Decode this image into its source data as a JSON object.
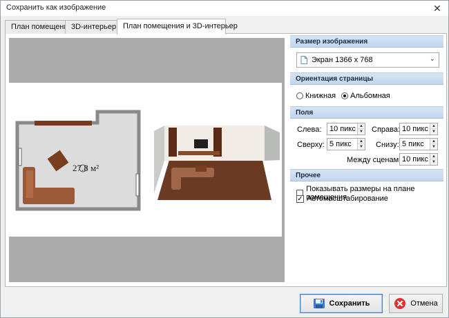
{
  "window": {
    "title": "Сохранить как изображение"
  },
  "tabs": [
    {
      "label": "План помещения"
    },
    {
      "label": "3D-интерьер"
    },
    {
      "label": "План помещения и 3D-интерьер"
    }
  ],
  "preview": {
    "area_label": "27.8 м²"
  },
  "size_section": {
    "header": "Размер изображения",
    "selected": "Экран 1366 x 768"
  },
  "orientation": {
    "header": "Ориентация страницы",
    "portrait": "Книжная",
    "landscape": "Альбомная",
    "selected": "landscape"
  },
  "margins": {
    "header": "Поля",
    "left_label": "Слева:",
    "left_value": "10 пикс",
    "right_label": "Справа:",
    "right_value": "10 пикс",
    "top_label": "Сверху:",
    "top_value": "5 пикс",
    "bottom_label": "Снизу:",
    "bottom_value": "5 пикс",
    "between_label": "Между сценами:",
    "between_value": "10 пикс"
  },
  "other": {
    "header": "Прочее",
    "show_sizes": {
      "label": "Показывать размеры на плане помещения",
      "checked": false
    },
    "autoscale": {
      "label": "Автомасштабирование",
      "checked": true
    }
  },
  "buttons": {
    "save": "Сохранить",
    "cancel": "Отмена"
  }
}
